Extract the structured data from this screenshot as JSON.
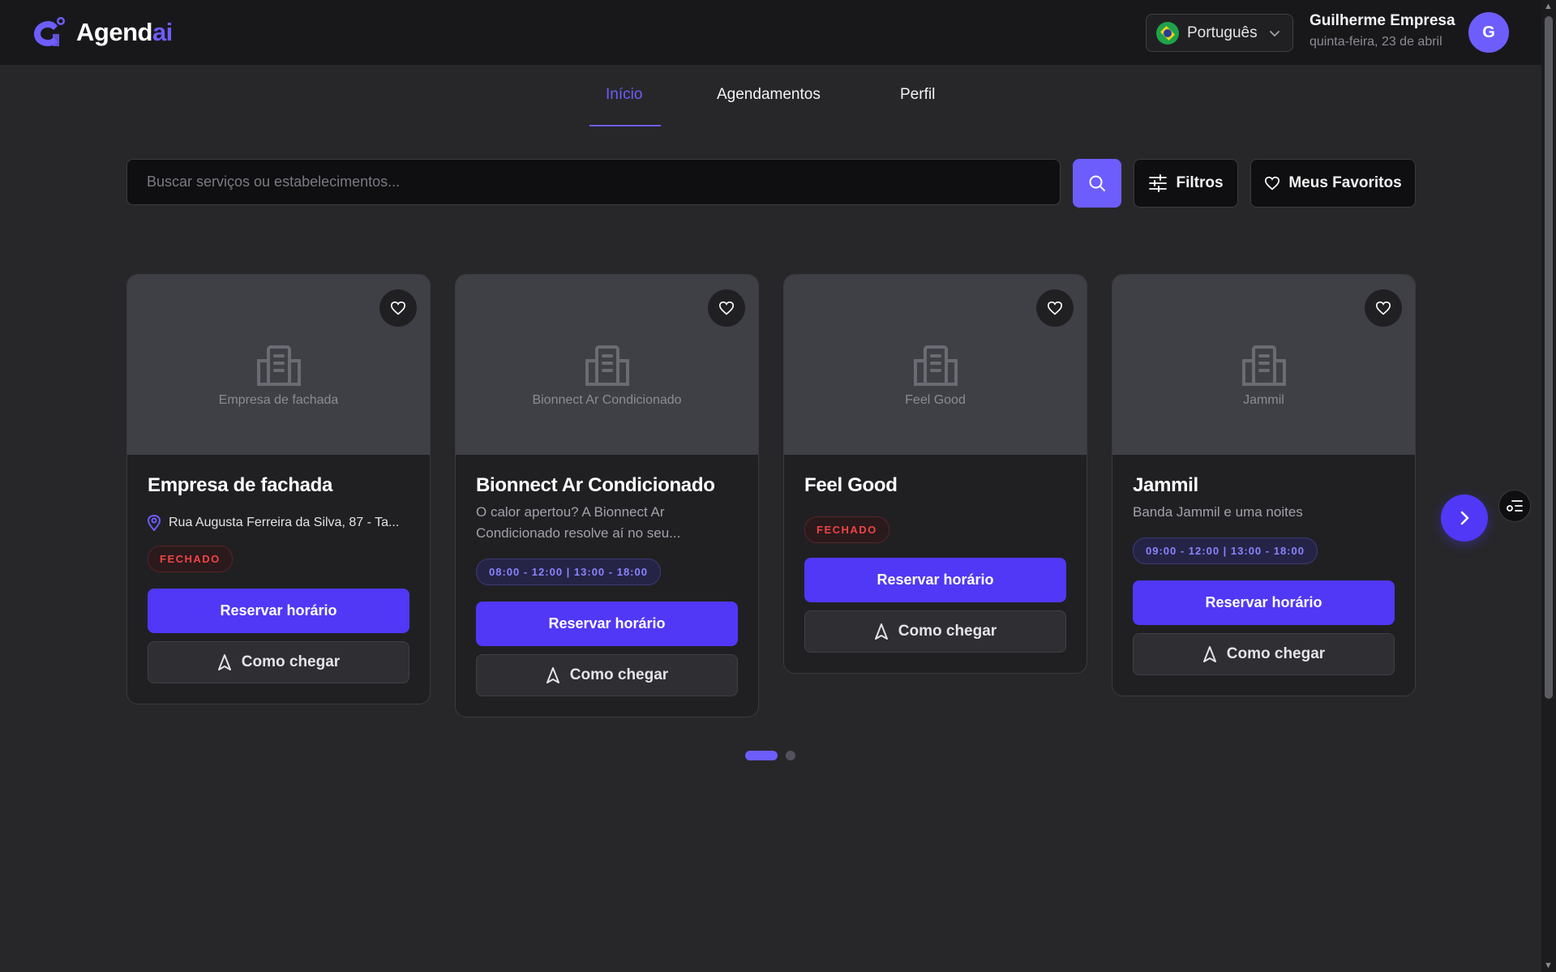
{
  "brand": {
    "name_main": "Agend",
    "name_accent": "ai"
  },
  "language": {
    "label": "Português"
  },
  "user": {
    "name": "Guilherme Empresa",
    "date": "quinta-feira, 23 de abril",
    "initial": "G"
  },
  "nav": {
    "tabs": [
      {
        "label": "Início",
        "active": true
      },
      {
        "label": "Agendamentos",
        "active": false
      },
      {
        "label": "Perfil",
        "active": false
      }
    ]
  },
  "search": {
    "placeholder": "Buscar serviços ou estabelecimentos...",
    "value": ""
  },
  "toolbar": {
    "filters_label": "Filtros",
    "favorites_label": "Meus Favoritos"
  },
  "cards": [
    {
      "image_caption": "Empresa de fachada",
      "title": "Empresa de fachada",
      "address": "Rua Augusta Ferreira da Silva, 87 - Ta...",
      "status": "FECHADO",
      "book_label": "Reservar horário",
      "directions_label": "Como chegar"
    },
    {
      "image_caption": "Bionnect Ar Condicionado",
      "title": "Bionnect Ar Condicionado",
      "description": "O calor apertou? A Bionnect Ar Condicionado resolve aí no seu...",
      "hours": "08:00 - 12:00 | 13:00 - 18:00",
      "book_label": "Reservar horário",
      "directions_label": "Como chegar"
    },
    {
      "image_caption": "Feel Good",
      "title": "Feel Good",
      "status": "FECHADO",
      "book_label": "Reservar horário",
      "directions_label": "Como chegar"
    },
    {
      "image_caption": "Jammil",
      "title": "Jammil",
      "description": "Banda Jammil e uma noites",
      "hours": "09:00 - 12:00 | 13:00 - 18:00",
      "book_label": "Reservar horário",
      "directions_label": "Como chegar"
    }
  ],
  "carousel": {
    "pages": 2,
    "current": 1
  },
  "colors": {
    "accent": "#6d5dfc",
    "primary_button": "#5038f6",
    "closed": "#ef4444",
    "background": "#27272a",
    "header": "#18181b"
  }
}
